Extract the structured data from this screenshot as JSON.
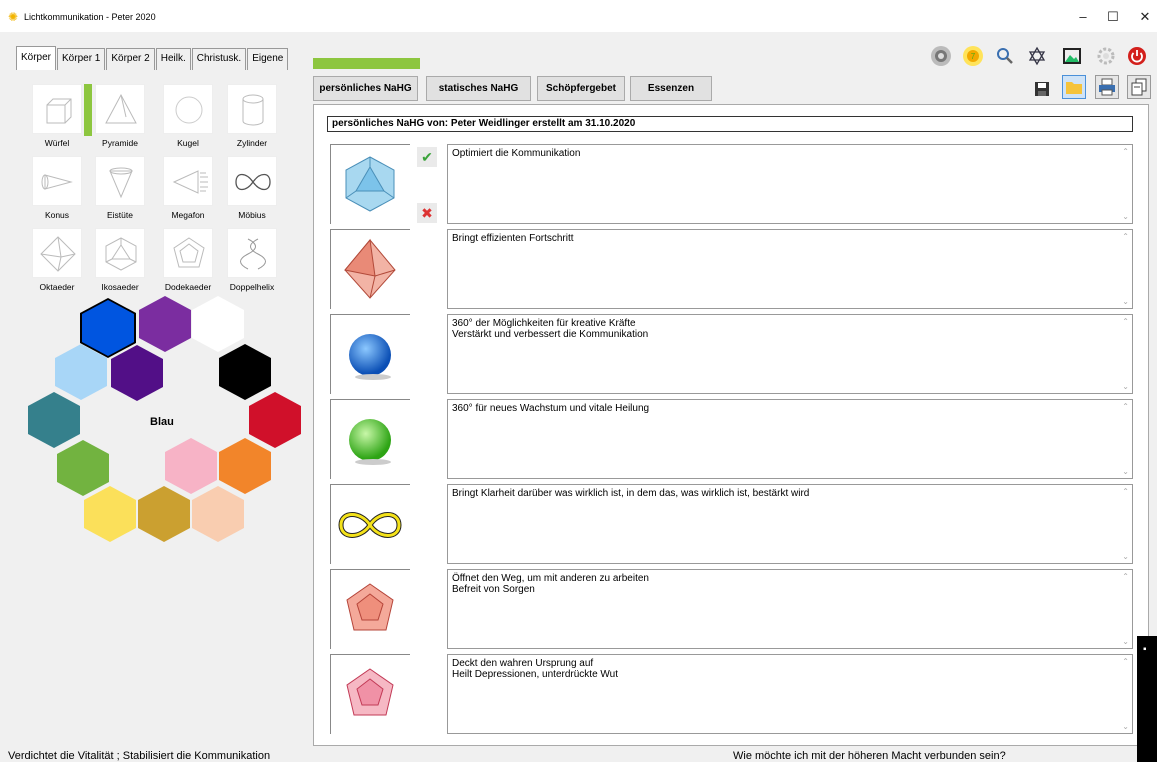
{
  "window": {
    "title": "Lichtkommunikation  - Peter 2020",
    "app_icon": "sun-icon",
    "minimize": "–",
    "maximize": "☐",
    "close": "✕"
  },
  "tabs": [
    "Körper",
    "Körper 1",
    "Körper 2",
    "Heilk.",
    "Christusk.",
    "Eigene"
  ],
  "active_tab": "Körper",
  "shapes": [
    {
      "label": "Würfel",
      "icon": "cube-icon"
    },
    {
      "label": "Pyramide",
      "icon": "pyramid-icon"
    },
    {
      "label": "Kugel",
      "icon": "sphere-icon"
    },
    {
      "label": "Zylinder",
      "icon": "cylinder-icon"
    },
    {
      "label": "Konus",
      "icon": "cone-icon"
    },
    {
      "label": "Eistüte",
      "icon": "icecream-cone-icon"
    },
    {
      "label": "Megafon",
      "icon": "megaphone-icon"
    },
    {
      "label": "Möbius",
      "icon": "moebius-icon"
    },
    {
      "label": "Oktaeder",
      "icon": "octahedron-icon"
    },
    {
      "label": "Ikosaeder",
      "icon": "icosahedron-icon"
    },
    {
      "label": "Dodekaeder",
      "icon": "dodecahedron-icon"
    },
    {
      "label": "Doppelhelix",
      "icon": "double-helix-icon"
    }
  ],
  "colors": {
    "selected_name": "Blau",
    "swatches": [
      "#0055e0",
      "#7b2da0",
      "#ffffff",
      "#000000",
      "#d0102a",
      "#f2852a",
      "#f9cdb0",
      "#cba030",
      "#fbe05a",
      "#72b340",
      "#35808c",
      "#a8d6f7",
      "#520f87",
      "#f7b3c6"
    ]
  },
  "toolbar": {
    "top_icons": [
      "chakra-icon",
      "sun-icon",
      "search-icon",
      "star-of-david-icon",
      "image-icon",
      "gear-icon",
      "power-icon"
    ],
    "bottom_icons": [
      "save-icon",
      "folder-icon",
      "print-icon",
      "export-icon"
    ]
  },
  "progress": {
    "fraction": 1.0
  },
  "subtabs": [
    "persönliches NaHG",
    "statisches NaHG",
    "Schöpfergebet",
    "Essenzen"
  ],
  "header": "persönliches NaHG von: Peter Weidlinger erstellt am 31.10.2020",
  "entries": [
    {
      "image": "icosahedron-blue",
      "text": "Optimiert die Kommunikation"
    },
    {
      "image": "octahedron-red",
      "text": "Bringt effizienten Fortschritt"
    },
    {
      "image": "sphere-blue",
      "text": "360° der Möglichkeiten für kreative Kräfte\nVerstärkt und verbessert die Kommunikation"
    },
    {
      "image": "sphere-green",
      "text": "360° für neues Wachstum und vitale Heilung"
    },
    {
      "image": "infinity-yellow",
      "text": "Bringt Klarheit darüber was wirklich ist, in dem das, was wirklich ist, bestärkt wird"
    },
    {
      "image": "dodecahedron-red",
      "text": "Öffnet den Weg, um mit anderen zu arbeiten\nBefreit von Sorgen"
    },
    {
      "image": "dodecahedron-pink",
      "text": "Deckt den wahren Ursprung auf\nHeilt Depressionen, unterdrückte Wut"
    }
  ],
  "status": {
    "left": "Verdichtet die Vitalität  ;  Stabilisiert die Kommunikation",
    "right": "Wie möchte ich mit der höheren Macht verbunden sein?"
  }
}
